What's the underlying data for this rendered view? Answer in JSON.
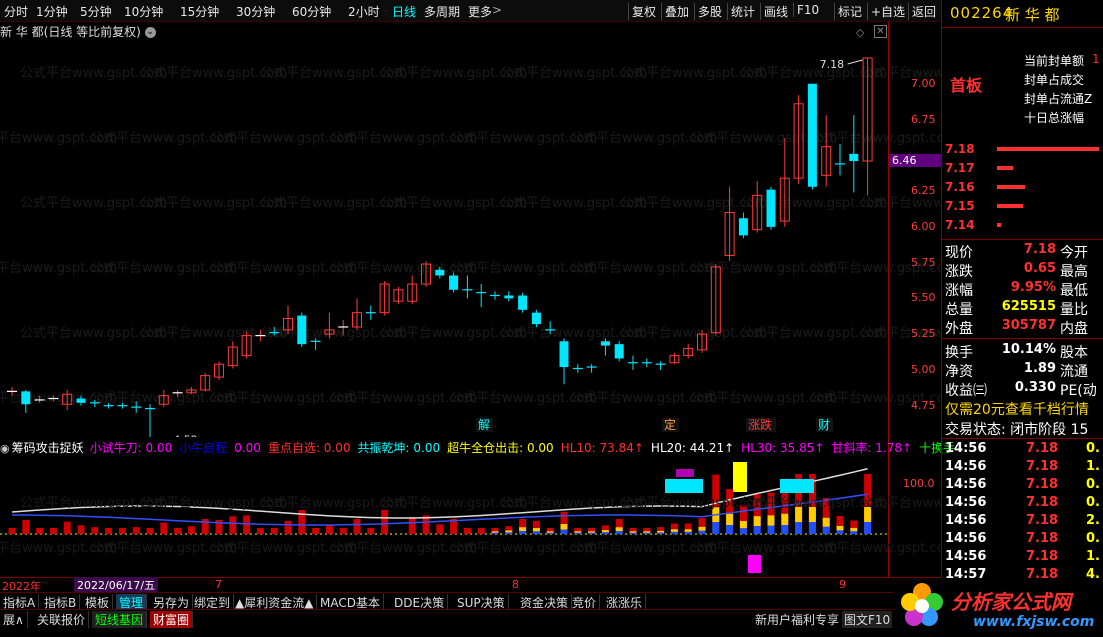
{
  "toolbar": {
    "periods": [
      "分时",
      "1分钟",
      "5分钟",
      "10分钟",
      "15分钟",
      "30分钟",
      "60分钟",
      "2小时",
      "日线",
      "多周期",
      "更多"
    ],
    "active_period": "日线",
    "more_arrow": ">",
    "actions": [
      "复权",
      "叠加",
      "多股",
      "统计",
      "画线",
      "F10",
      "标记",
      "+自选",
      "返回"
    ]
  },
  "stock": {
    "code": "002264",
    "name": "新 华 都"
  },
  "chart_title": {
    "name": "新 华 都",
    "subtitle": "(日线 等比前复权)"
  },
  "watermark": "公式平台www.gspt.com",
  "price_axis": {
    "ticks": [
      "7.00",
      "6.75",
      "6.50",
      "6.25",
      "6.00",
      "5.75",
      "5.50",
      "5.25",
      "5.00",
      "4.75"
    ],
    "current_tag": "6.46"
  },
  "annotations": {
    "high": "7.18",
    "low": "4.52",
    "events": [
      "解",
      "定",
      "涨跌",
      "财"
    ]
  },
  "chart_data": {
    "type": "candlestick",
    "ylim": [
      4.58,
      7.18
    ],
    "candles": [
      {
        "o": 4.85,
        "c": 4.85,
        "h": 4.88,
        "l": 4.82,
        "up": true
      },
      {
        "o": 4.85,
        "c": 4.76,
        "h": 4.86,
        "l": 4.7,
        "up": false
      },
      {
        "o": 4.79,
        "c": 4.79,
        "h": 4.82,
        "l": 4.77,
        "up": true
      },
      {
        "o": 4.8,
        "c": 4.8,
        "h": 4.82,
        "l": 4.78,
        "up": true
      },
      {
        "o": 4.76,
        "c": 4.83,
        "h": 4.86,
        "l": 4.72,
        "up": true
      },
      {
        "o": 4.8,
        "c": 4.77,
        "h": 4.82,
        "l": 4.75,
        "up": false
      },
      {
        "o": 4.77,
        "c": 4.76,
        "h": 4.79,
        "l": 4.74,
        "up": false
      },
      {
        "o": 4.75,
        "c": 4.75,
        "h": 4.77,
        "l": 4.73,
        "up": false
      },
      {
        "o": 4.75,
        "c": 4.75,
        "h": 4.77,
        "l": 4.73,
        "up": false
      },
      {
        "o": 4.74,
        "c": 4.73,
        "h": 4.78,
        "l": 4.7,
        "up": false
      },
      {
        "o": 4.73,
        "c": 4.73,
        "h": 4.76,
        "l": 4.52,
        "up": false
      },
      {
        "o": 4.76,
        "c": 4.82,
        "h": 4.86,
        "l": 4.74,
        "up": true
      },
      {
        "o": 4.84,
        "c": 4.84,
        "h": 4.86,
        "l": 4.81,
        "up": true
      },
      {
        "o": 4.84,
        "c": 4.86,
        "h": 4.88,
        "l": 4.83,
        "up": true
      },
      {
        "o": 4.86,
        "c": 4.96,
        "h": 4.98,
        "l": 4.85,
        "up": true
      },
      {
        "o": 4.95,
        "c": 5.04,
        "h": 5.06,
        "l": 4.93,
        "up": true
      },
      {
        "o": 5.03,
        "c": 5.16,
        "h": 5.2,
        "l": 5.01,
        "up": true
      },
      {
        "o": 5.1,
        "c": 5.24,
        "h": 5.27,
        "l": 5.08,
        "up": true
      },
      {
        "o": 5.24,
        "c": 5.24,
        "h": 5.28,
        "l": 5.2,
        "up": true
      },
      {
        "o": 5.26,
        "c": 5.26,
        "h": 5.3,
        "l": 5.24,
        "up": false
      },
      {
        "o": 5.28,
        "c": 5.36,
        "h": 5.45,
        "l": 5.25,
        "up": true
      },
      {
        "o": 5.38,
        "c": 5.18,
        "h": 5.4,
        "l": 5.16,
        "up": false
      },
      {
        "o": 5.2,
        "c": 5.2,
        "h": 5.22,
        "l": 5.14,
        "up": false
      },
      {
        "o": 5.25,
        "c": 5.28,
        "h": 5.4,
        "l": 5.22,
        "up": true
      },
      {
        "o": 5.3,
        "c": 5.3,
        "h": 5.35,
        "l": 5.24,
        "up": true
      },
      {
        "o": 5.3,
        "c": 5.4,
        "h": 5.5,
        "l": 5.28,
        "up": true
      },
      {
        "o": 5.4,
        "c": 5.4,
        "h": 5.45,
        "l": 5.35,
        "up": false
      },
      {
        "o": 5.4,
        "c": 5.6,
        "h": 5.62,
        "l": 5.38,
        "up": true
      },
      {
        "o": 5.56,
        "c": 5.48,
        "h": 5.58,
        "l": 5.46,
        "up": true
      },
      {
        "o": 5.48,
        "c": 5.6,
        "h": 5.66,
        "l": 5.46,
        "up": true
      },
      {
        "o": 5.6,
        "c": 5.74,
        "h": 5.76,
        "l": 5.58,
        "up": true
      },
      {
        "o": 5.7,
        "c": 5.66,
        "h": 5.72,
        "l": 5.64,
        "up": false
      },
      {
        "o": 5.66,
        "c": 5.56,
        "h": 5.68,
        "l": 5.54,
        "up": false
      },
      {
        "o": 5.56,
        "c": 5.56,
        "h": 5.66,
        "l": 5.5,
        "up": false
      },
      {
        "o": 5.54,
        "c": 5.54,
        "h": 5.6,
        "l": 5.44,
        "up": false
      },
      {
        "o": 5.52,
        "c": 5.52,
        "h": 5.55,
        "l": 5.49,
        "up": false
      },
      {
        "o": 5.52,
        "c": 5.5,
        "h": 5.55,
        "l": 5.48,
        "up": false
      },
      {
        "o": 5.52,
        "c": 5.42,
        "h": 5.54,
        "l": 5.4,
        "up": false
      },
      {
        "o": 5.4,
        "c": 5.32,
        "h": 5.42,
        "l": 5.3,
        "up": false
      },
      {
        "o": 5.28,
        "c": 5.28,
        "h": 5.34,
        "l": 5.25,
        "up": false
      },
      {
        "o": 5.2,
        "c": 5.02,
        "h": 5.22,
        "l": 4.9,
        "up": false
      },
      {
        "o": 5.01,
        "c": 5.01,
        "h": 5.04,
        "l": 4.98,
        "up": false
      },
      {
        "o": 5.02,
        "c": 5.02,
        "h": 5.04,
        "l": 4.98,
        "up": false
      },
      {
        "o": 5.2,
        "c": 5.17,
        "h": 5.22,
        "l": 5.1,
        "up": false
      },
      {
        "o": 5.18,
        "c": 5.08,
        "h": 5.2,
        "l": 5.06,
        "up": false
      },
      {
        "o": 5.05,
        "c": 5.05,
        "h": 5.1,
        "l": 5.0,
        "up": false
      },
      {
        "o": 5.05,
        "c": 5.05,
        "h": 5.08,
        "l": 5.02,
        "up": false
      },
      {
        "o": 5.04,
        "c": 5.03,
        "h": 5.06,
        "l": 5.0,
        "up": false
      },
      {
        "o": 5.05,
        "c": 5.1,
        "h": 5.12,
        "l": 5.04,
        "up": true
      },
      {
        "o": 5.1,
        "c": 5.15,
        "h": 5.18,
        "l": 5.08,
        "up": true
      },
      {
        "o": 5.14,
        "c": 5.25,
        "h": 5.28,
        "l": 5.12,
        "up": true
      },
      {
        "o": 5.26,
        "c": 5.72,
        "h": 5.74,
        "l": 5.24,
        "up": true
      },
      {
        "o": 5.8,
        "c": 6.1,
        "h": 6.28,
        "l": 5.76,
        "up": true
      },
      {
        "o": 6.06,
        "c": 5.94,
        "h": 6.1,
        "l": 5.92,
        "up": false
      },
      {
        "o": 5.98,
        "c": 6.22,
        "h": 6.32,
        "l": 5.96,
        "up": true
      },
      {
        "o": 6.26,
        "c": 6.0,
        "h": 6.28,
        "l": 5.98,
        "up": false
      },
      {
        "o": 6.04,
        "c": 6.34,
        "h": 6.62,
        "l": 6.0,
        "up": true
      },
      {
        "o": 6.34,
        "c": 6.86,
        "h": 6.92,
        "l": 6.3,
        "up": true
      },
      {
        "o": 7.0,
        "c": 6.28,
        "h": 7.0,
        "l": 6.26,
        "up": false
      },
      {
        "o": 6.36,
        "c": 6.56,
        "h": 6.78,
        "l": 6.28,
        "up": true
      },
      {
        "o": 6.44,
        "c": 6.44,
        "h": 6.58,
        "l": 6.36,
        "up": false
      },
      {
        "o": 6.46,
        "c": 6.51,
        "h": 6.78,
        "l": 6.24,
        "up": false
      },
      {
        "o": 6.46,
        "c": 7.18,
        "h": 7.18,
        "l": 6.22,
        "up": true
      }
    ]
  },
  "indicator": {
    "name": "筹码攻击捉妖",
    "items": [
      {
        "label": "小试牛刀: 0.00",
        "color": "#ff00ff"
      },
      {
        "label": "小牛启程",
        "color": "#0000ff"
      },
      {
        "label": "0.00",
        "color": "#ff00ff"
      },
      {
        "label": "重点自选: 0.00",
        "color": "#ff3030"
      },
      {
        "label": "共振乾坤: 0.00",
        "color": "#00ffff"
      },
      {
        "label": "超牛全仓出击: 0.00",
        "color": "#ffff00"
      },
      {
        "label": "HL10: 73.84↑",
        "color": "#ff3030"
      },
      {
        "label": "HL20: 44.21↑",
        "color": "#ffffff"
      },
      {
        "label": "HL30: 35.85↑",
        "color": "#ff00ff"
      },
      {
        "label": "甘斜率: 1.78↑",
        "color": "#ff00ff"
      },
      {
        "label": "十换手",
        "color": "#00ff00"
      }
    ],
    "axis_value": "100.0"
  },
  "dates": {
    "year": "2022年",
    "cursor": "2022/06/17/五",
    "month7": "7",
    "month8": "8",
    "month9": "9"
  },
  "tabs_row1": [
    "指标A",
    "指标B",
    "模板",
    "管理",
    "另存为",
    "绑定到",
    "▲犀利资金流▲",
    "MACD基本",
    "DDE决策",
    "SUP决策",
    "资金决策",
    "竞价",
    "涨涨乐"
  ],
  "tabs_row2": [
    "展∧",
    "关联报价",
    "短线基因",
    "财富圈"
  ],
  "promo": "新用户福利专享",
  "f10": "图文F10",
  "rp": {
    "seal": [
      "当前封单额",
      "封单占成交",
      "封单占流通Z",
      "十日总涨幅"
    ],
    "seal_vals": [
      "1",
      "",
      "",
      ""
    ],
    "badge": "首板",
    "ladder": [
      {
        "p": "7.18",
        "w": 102
      },
      {
        "p": "7.17",
        "w": 16
      },
      {
        "p": "7.16",
        "w": 28
      },
      {
        "p": "7.15",
        "w": 26
      },
      {
        "p": "7.14",
        "w": 4
      }
    ],
    "quote": [
      {
        "k": "现价",
        "v": "7.18",
        "vc": "#ff3030",
        "k2": "今开"
      },
      {
        "k": "涨跌",
        "v": "0.65",
        "vc": "#ff3030",
        "k2": "最高"
      },
      {
        "k": "涨幅",
        "v": "9.95%",
        "vc": "#ff3030",
        "k2": "最低"
      },
      {
        "k": "总量",
        "v": "625515",
        "vc": "#ffff00",
        "k2": "量比"
      },
      {
        "k": "外盘",
        "v": "305787",
        "vc": "#ff3030",
        "k2": "内盘"
      },
      {
        "k": "换手",
        "v": "10.14%",
        "vc": "#ffffff",
        "k2": "股本"
      },
      {
        "k": "净资",
        "v": "1.89",
        "vc": "#ffffff",
        "k2": "流通"
      },
      {
        "k": "收益㈢",
        "v": "0.330",
        "vc": "#ffffff",
        "k2": "PE(动"
      }
    ],
    "ad": "仅需20元查看千档行情",
    "state": "交易状态: 闭市阶段 15",
    "ticks": [
      {
        "t": "14:56",
        "p": "7.18",
        "v": "0."
      },
      {
        "t": "14:56",
        "p": "7.18",
        "v": "1."
      },
      {
        "t": "14:56",
        "p": "7.18",
        "v": "0."
      },
      {
        "t": "14:56",
        "p": "7.18",
        "v": "0."
      },
      {
        "t": "14:56",
        "p": "7.18",
        "v": "2."
      },
      {
        "t": "14:56",
        "p": "7.18",
        "v": "0."
      },
      {
        "t": "14:56",
        "p": "7.18",
        "v": "1."
      },
      {
        "t": "14:57",
        "p": "7.18",
        "v": "4."
      }
    ]
  },
  "logo": {
    "cn": "分析家公式网",
    "url": "www.fxjsw.com"
  }
}
